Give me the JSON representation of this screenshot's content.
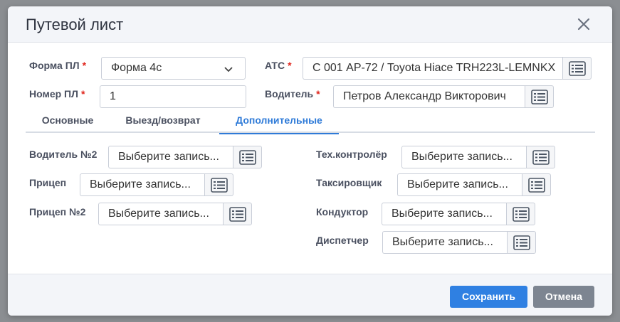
{
  "dialog": {
    "title": "Путевой лист"
  },
  "fields": {
    "forma_pl": {
      "label": "Форма ПЛ",
      "required_mark": "*",
      "value": "Форма 4с"
    },
    "nomer_pl": {
      "label": "Номер ПЛ",
      "required_mark": "*",
      "value": "1"
    },
    "ats": {
      "label": "АТС",
      "required_mark": "*",
      "value": "С 001 АР-72 / Toyota Hiace TRH223L-LEMNKX"
    },
    "voditel": {
      "label": "Водитель",
      "required_mark": "*",
      "value": "Петров Александр Викторович"
    }
  },
  "tabs": [
    {
      "label": "Основные",
      "active": false
    },
    {
      "label": "Выезд/возврат",
      "active": false
    },
    {
      "label": "Дополнительные",
      "active": true
    }
  ],
  "extra": {
    "voditel2": {
      "label": "Водитель №2",
      "placeholder": "Выберите запись..."
    },
    "pricep": {
      "label": "Прицеп",
      "placeholder": "Выберите запись..."
    },
    "pricep2": {
      "label": "Прицеп №2",
      "placeholder": "Выберите запись..."
    },
    "tekh_kontroler": {
      "label": "Тех.контролёр",
      "placeholder": "Выберите запись..."
    },
    "taksirovshchik": {
      "label": "Таксировщик",
      "placeholder": "Выберите запись..."
    },
    "konduktor": {
      "label": "Кондуктор",
      "placeholder": "Выберите запись..."
    },
    "dispetcher": {
      "label": "Диспетчер",
      "placeholder": "Выберите запись..."
    }
  },
  "footer": {
    "save_label": "Сохранить",
    "cancel_label": "Отмена"
  },
  "colors": {
    "accent": "#2f80e2",
    "required": "#e0261d",
    "cancel": "#7d8591"
  },
  "icons": {
    "close": "close-icon",
    "lookup": "list-icon",
    "dropdown": "chevron-down-icon"
  }
}
